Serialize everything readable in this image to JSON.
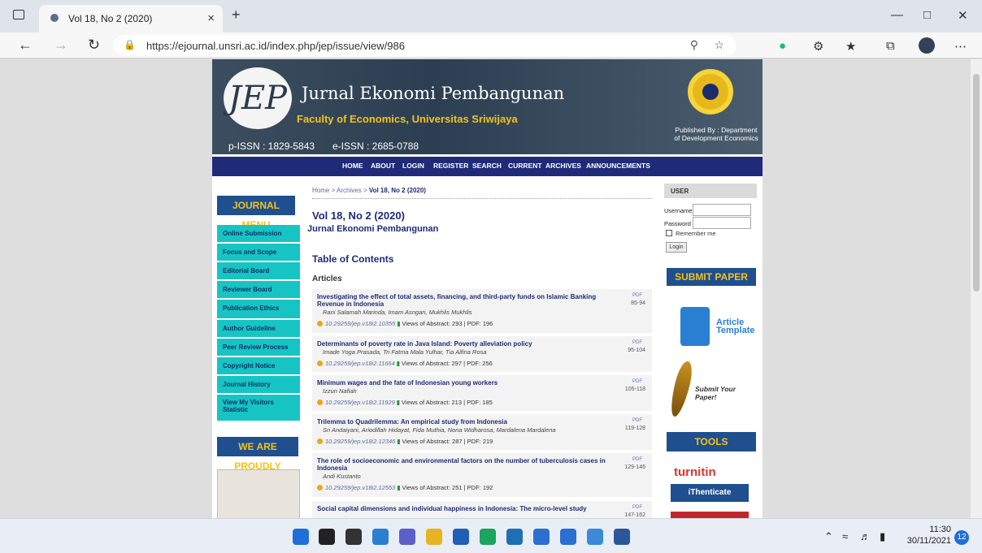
{
  "browser": {
    "tab_title": "Vol 18, No 2 (2020)",
    "tab_close": "×",
    "new_tab": "+",
    "url": "https://ejournal.unsri.ac.id/index.php/jep/issue/view/986",
    "icons": [
      "back-icon",
      "forward-icon",
      "refresh-icon",
      "lock-icon",
      "zoom-icon",
      "read-aloud-icon",
      "grammarly-icon",
      "extensions-icon",
      "favorites-icon",
      "collections-icon",
      "profile-icon",
      "more-icon"
    ]
  },
  "banner": {
    "title": "Jurnal Ekonomi Pembangunan",
    "subtitle": "Faculty of Economics, Universitas Sriwijaya",
    "logo_text": "JEP",
    "p_issn": "p-ISSN : 1829-5843",
    "e_issn": "e-ISSN : 2685-0788",
    "published_by": "Published By : Department of Development Economics"
  },
  "nav": [
    "HOME",
    "ABOUT",
    "LOGIN",
    "REGISTER",
    "SEARCH",
    "CURRENT",
    "ARCHIVES",
    "ANNOUNCEMENTS"
  ],
  "left_sidebar": {
    "menu_title": "JOURNAL MENU",
    "items": [
      "Online Submission",
      "Focus and Scope",
      "Editorial Board",
      "Reviewer Board",
      "Publication Ethics",
      "Author Guideline",
      "Peer Review Process",
      "Copyright Notice",
      "Journal History",
      "View My Visitors Statistic"
    ],
    "proudly_title": "WE ARE PROUDLY"
  },
  "breadcrumb": {
    "home": "Home",
    "sep": ">",
    "archives": "Archives",
    "current": "Vol 18, No 2 (2020)"
  },
  "issue_title": "Vol 18, No 2 (2020)",
  "journal_name": "Jurnal Ekonomi Pembangunan",
  "toc_title": "Table of Contents",
  "section": "Articles",
  "articles": [
    {
      "title": "Investigating the effect of total assets, financing, and third-party funds on Islamic Banking Revenue in Indonesia",
      "authors": "Rani Salamah Marinda, Imam Asngari, Mukhlis Mukhlis",
      "doi": "10.29259/jep.v18i2.10355",
      "stats": "Views of Abstract: 293 | PDF: 196",
      "pdf": "PDF",
      "pages": "85-94"
    },
    {
      "title": "Determinants of poverty rate in Java Island: Poverty alleviation policy",
      "authors": "Imade Yoga Prasada, Tri Fatma Mala Yulhar, Tia Alfina Rosa",
      "doi": "10.29259/jep.v18i2.11664",
      "stats": "Views of Abstract: 297 | PDF: 256",
      "pdf": "PDF",
      "pages": "95-104"
    },
    {
      "title": "Minimum wages and the fate of Indonesian young workers",
      "authors": "Izzun Nafiah",
      "doi": "10.29259/jep.v18i2.11929",
      "stats": "Views of Abstract: 213 | PDF: 185",
      "pdf": "PDF",
      "pages": "105-118"
    },
    {
      "title": "Trilemma to Quadrilemma: An empirical study from Indonesia",
      "authors": "Sri Andaiyani, Ariodillah Hidayat, Fida Muthia, Nona Widharosa, Mardalena Mardalena",
      "doi": "10.29259/jep.v18i2.12346",
      "stats": "Views of Abstract: 287 | PDF: 219",
      "pdf": "PDF",
      "pages": "119-128"
    },
    {
      "title": "The role of socioeconomic and environmental factors on the number of tuberculosis cases in Indonesia",
      "authors": "Andi Kustanto",
      "doi": "10.29259/jep.v18i2.12553",
      "stats": "Views of Abstract: 251 | PDF: 192",
      "pdf": "PDF",
      "pages": "129-146"
    },
    {
      "title": "Social capital dimensions and individual happiness in Indonesia: The micro-level study",
      "authors": "",
      "doi": "",
      "stats": "",
      "pdf": "PDF",
      "pages": "147-162"
    }
  ],
  "right_sidebar": {
    "user_title": "USER",
    "username_label": "Username",
    "password_label": "Password",
    "remember": "Remember me",
    "login_button": "Login",
    "submit_title": "SUBMIT PAPER",
    "article_template": "Article Template",
    "submit_your_paper": "Submit Your Paper!",
    "tools_title": "TOOLS",
    "turnitin": "turnitin",
    "ithenticate": "iThenticate"
  },
  "taskbar": {
    "time": "11:30",
    "date": "30/11/2021",
    "notifications": "12",
    "icons": [
      "start-icon",
      "search-icon",
      "widgets-icon",
      "task-view-icon",
      "chat-icon",
      "file-explorer-icon",
      "store-icon",
      "edge-icon",
      "mail-icon",
      "vscode-icon",
      "notepad-icon",
      "photos-icon",
      "word-icon"
    ],
    "icon_colors": [
      "#1e6fd9",
      "#222",
      "#333",
      "#2a7fd3",
      "#5b5fc7",
      "#e6b422",
      "#1f5fb5",
      "#1aa65c",
      "#1f6fb5",
      "#2a6fd1",
      "#2a6fd1",
      "#3a8ad8",
      "#2b579a"
    ]
  }
}
